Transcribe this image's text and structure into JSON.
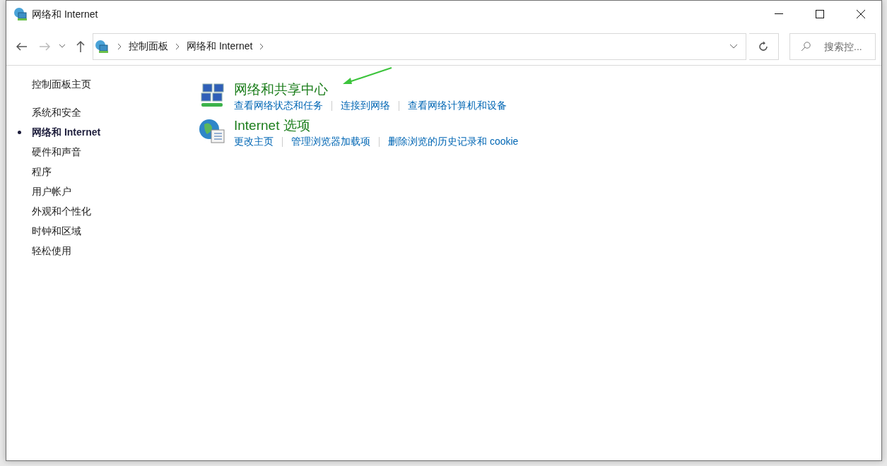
{
  "window": {
    "title": "网络和 Internet"
  },
  "address_bar": {
    "breadcrumbs": [
      "控制面板",
      "网络和 Internet"
    ]
  },
  "search": {
    "placeholder": "搜索控..."
  },
  "sidebar": {
    "home": "控制面板主页",
    "items": [
      {
        "label": "系统和安全",
        "selected": false
      },
      {
        "label": "网络和 Internet",
        "selected": true
      },
      {
        "label": "硬件和声音",
        "selected": false
      },
      {
        "label": "程序",
        "selected": false
      },
      {
        "label": "用户帐户",
        "selected": false
      },
      {
        "label": "外观和个性化",
        "selected": false
      },
      {
        "label": "时钟和区域",
        "selected": false
      },
      {
        "label": "轻松使用",
        "selected": false
      }
    ]
  },
  "categories": [
    {
      "kind": "network",
      "title": "网络和共享中心",
      "links": [
        "查看网络状态和任务",
        "连接到网络",
        "查看网络计算机和设备"
      ]
    },
    {
      "kind": "internet",
      "title": "Internet 选项",
      "links": [
        "更改主页",
        "管理浏览器加载项",
        "删除浏览的历史记录和 cookie"
      ]
    }
  ]
}
